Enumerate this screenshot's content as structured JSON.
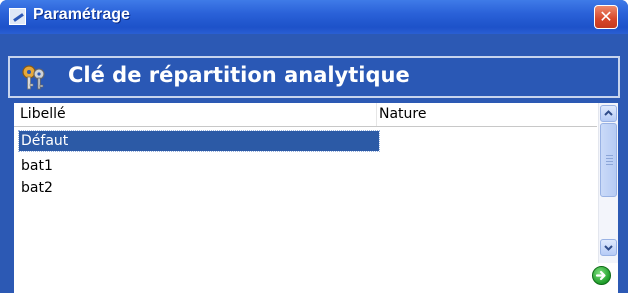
{
  "window": {
    "title": "Paramétrage",
    "close_glyph": "✕"
  },
  "header": {
    "title": "Clé de répartition analytique",
    "icon": "keys-icon"
  },
  "table": {
    "columns": [
      "Libellé",
      "Nature"
    ],
    "rows": [
      {
        "libelle": "Défaut",
        "nature": "",
        "selected": true
      },
      {
        "libelle": "bat1",
        "nature": "",
        "selected": false
      },
      {
        "libelle": "bat2",
        "nature": "",
        "selected": false
      }
    ]
  },
  "icons": {
    "title_icon": "settings-window-icon",
    "go": "go-arrow-icon"
  },
  "colors": {
    "title_bar": "#2a61d8",
    "header_band": "#2a58b5",
    "selection": "#2c5aa6",
    "close_button": "#d6462a",
    "go_icon": "#1f9d2a"
  }
}
